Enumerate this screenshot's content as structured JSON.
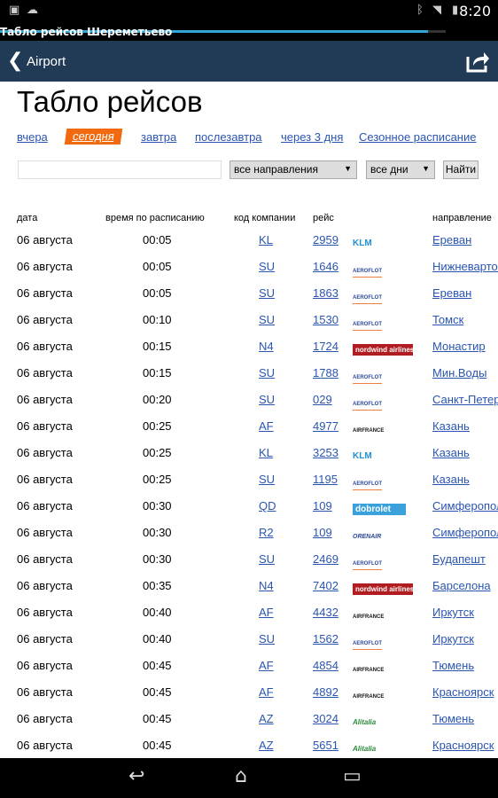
{
  "status": {
    "time": "8:20"
  },
  "window_title": "Табло рейсов Шереметьево",
  "progress": 0.96,
  "appbar": {
    "back": "Airport"
  },
  "title": "Табло рейсов",
  "tabs": [
    {
      "label": "вчера"
    },
    {
      "label": "сегодня",
      "active": true
    },
    {
      "label": "завтра"
    },
    {
      "label": "послезавтра"
    },
    {
      "label": "через 3 дня"
    },
    {
      "label": "Сезонное расписание"
    }
  ],
  "form": {
    "search_value": "",
    "direction": "все направления",
    "days": "все дни",
    "find": "Найти"
  },
  "columns": [
    "дата",
    "время по расписанию",
    "код компании",
    "рейс",
    "",
    "направление"
  ],
  "rows": [
    [
      "06 августа",
      "00:05",
      "KL",
      "2959",
      "KLM",
      "Ереван"
    ],
    [
      "06 августа",
      "00:05",
      "SU",
      "1646",
      "AEROFLOT",
      "Нижневартовск"
    ],
    [
      "06 августа",
      "00:05",
      "SU",
      "1863",
      "AEROFLOT",
      "Ереван"
    ],
    [
      "06 августа",
      "00:10",
      "SU",
      "1530",
      "AEROFLOT",
      "Томск"
    ],
    [
      "06 августа",
      "00:15",
      "N4",
      "1724",
      "NORDWIND",
      "Монастир"
    ],
    [
      "06 августа",
      "00:15",
      "SU",
      "1788",
      "AEROFLOT",
      "Мин.Воды"
    ],
    [
      "06 августа",
      "00:20",
      "SU",
      "029",
      "AEROFLOT",
      "Санкт-Петербург"
    ],
    [
      "06 августа",
      "00:25",
      "AF",
      "4977",
      "AIRFRANCE",
      "Казань"
    ],
    [
      "06 августа",
      "00:25",
      "KL",
      "3253",
      "KLM",
      "Казань"
    ],
    [
      "06 августа",
      "00:25",
      "SU",
      "1195",
      "AEROFLOT",
      "Казань"
    ],
    [
      "06 августа",
      "00:30",
      "QD",
      "109",
      "DOBROLET",
      "Симферополь"
    ],
    [
      "06 августа",
      "00:30",
      "R2",
      "109",
      "ORENAIR",
      "Симферополь"
    ],
    [
      "06 августа",
      "00:30",
      "SU",
      "2469",
      "AEROFLOT",
      "Будапешт"
    ],
    [
      "06 августа",
      "00:35",
      "N4",
      "7402",
      "NORDWIND",
      "Барселона"
    ],
    [
      "06 августа",
      "00:40",
      "AF",
      "4432",
      "AIRFRANCE",
      "Иркутск"
    ],
    [
      "06 августа",
      "00:40",
      "SU",
      "1562",
      "AEROFLOT",
      "Иркутск"
    ],
    [
      "06 августа",
      "00:45",
      "AF",
      "4854",
      "AIRFRANCE",
      "Тюмень"
    ],
    [
      "06 августа",
      "00:45",
      "AF",
      "4892",
      "AIRFRANCE",
      "Красноярск"
    ],
    [
      "06 августа",
      "00:45",
      "AZ",
      "3024",
      "ALITALIA",
      "Тюмень"
    ],
    [
      "06 августа",
      "00:45",
      "AZ",
      "5651",
      "ALITALIA",
      "Красноярск"
    ]
  ],
  "logo_text": {
    "KLM": "KLM",
    "AEROFLOT": "AEROFLOT",
    "NORDWIND": "nordwind airlines",
    "AIRFRANCE": "AIRFRANCE",
    "DOBROLET": "dobrolet",
    "ORENAIR": "ORENAIR",
    "ALITALIA": "Alitalia"
  },
  "colors": {
    "appbar": "#213a55",
    "active_tab": "#f26a10",
    "link": "#2a55b0"
  }
}
